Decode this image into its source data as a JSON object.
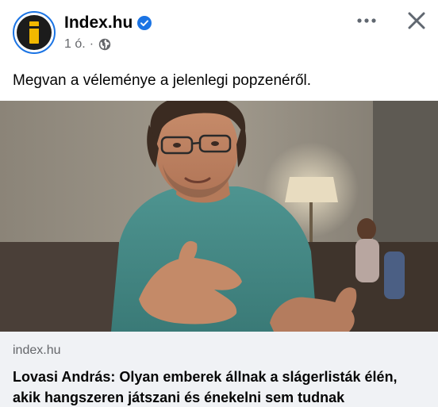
{
  "post": {
    "page_name": "Index.hu",
    "time": "1 ó.",
    "meta_separator": "·",
    "caption": "Megvan a véleménye a jelenlegi popzenéről.",
    "icons": {
      "verified": "verified-badge-icon",
      "audience": "globe-icon",
      "more": "more-options-icon",
      "close": "close-icon"
    },
    "colors": {
      "verified_blue": "#1b74e4",
      "avatar_accent": "#f2b800",
      "meta_gray": "#65676b",
      "footer_bg": "#f0f2f5"
    }
  },
  "link_preview": {
    "domain": "index.hu",
    "title": "Lovasi András: Olyan emberek állnak a slágerlisták élén, akik hangszeren játszani és énekelni sem tudnak"
  }
}
